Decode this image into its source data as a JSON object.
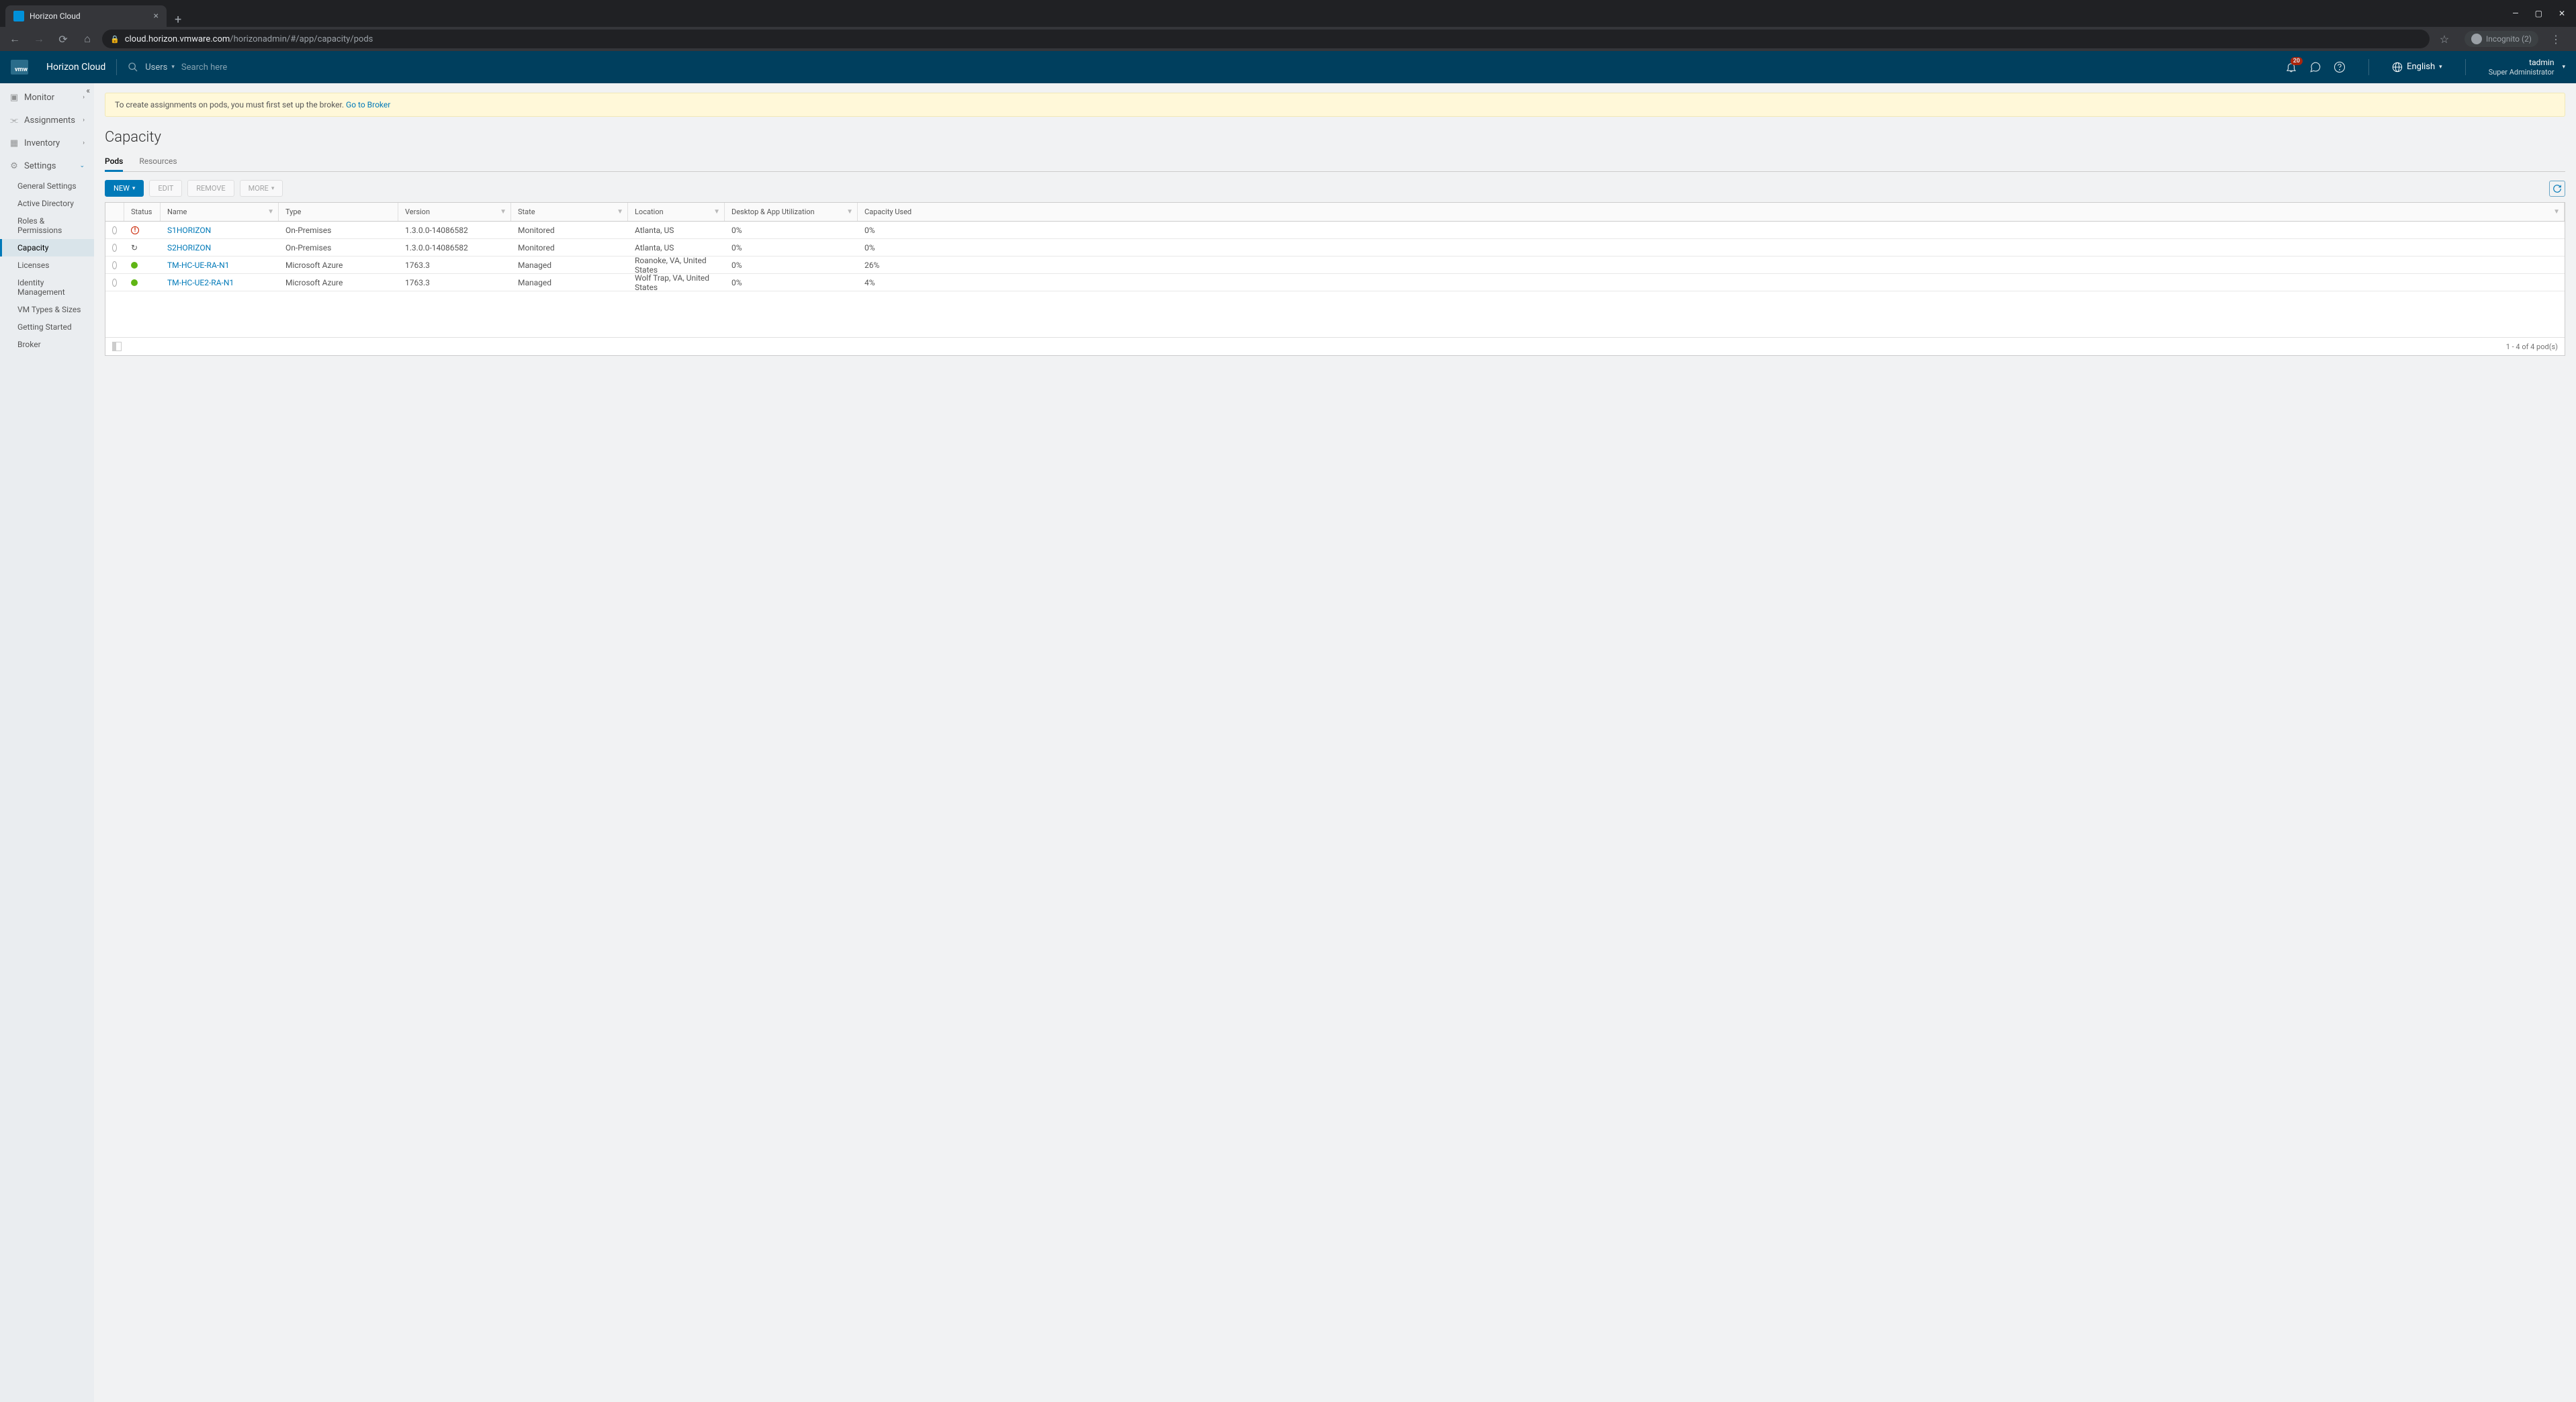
{
  "browser": {
    "tab_title": "Horizon Cloud",
    "url_domain": "cloud.horizon.vmware.com",
    "url_path": "/horizonadmin/#/app/capacity/pods",
    "incognito_label": "Incognito (2)"
  },
  "header": {
    "brand": "Horizon Cloud",
    "logo_text": "vmw",
    "users_label": "Users",
    "search_placeholder": "Search here",
    "notification_count": "20",
    "language": "English",
    "user_name": "tadmin",
    "user_role": "Super Administrator"
  },
  "sidebar": {
    "monitor": "Monitor",
    "assignments": "Assignments",
    "inventory": "Inventory",
    "settings": "Settings",
    "subs": {
      "general": "General Settings",
      "ad": "Active Directory",
      "roles": "Roles & Permissions",
      "capacity": "Capacity",
      "licenses": "Licenses",
      "identity": "Identity Management",
      "vmtypes": "VM Types & Sizes",
      "getting": "Getting Started",
      "broker": "Broker"
    }
  },
  "banner": {
    "text": "To create assignments on pods, you must first set up the broker. ",
    "link": "Go to Broker"
  },
  "page": {
    "title": "Capacity",
    "tabs": {
      "pods": "Pods",
      "resources": "Resources"
    },
    "toolbar": {
      "new": "NEW",
      "edit": "EDIT",
      "remove": "REMOVE",
      "more": "MORE"
    },
    "columns": {
      "status": "Status",
      "name": "Name",
      "type": "Type",
      "version": "Version",
      "state": "State",
      "location": "Location",
      "desktop": "Desktop & App Utilization",
      "capacity": "Capacity Used"
    },
    "rows": [
      {
        "status": "error",
        "name": "S1HORIZON",
        "type": "On-Premises",
        "version": "1.3.0.0-14086582",
        "state": "Monitored",
        "location": "Atlanta, US",
        "desktop": "0%",
        "capacity": "0%"
      },
      {
        "status": "sync",
        "name": "S2HORIZON",
        "type": "On-Premises",
        "version": "1.3.0.0-14086582",
        "state": "Monitored",
        "location": "Atlanta, US",
        "desktop": "0%",
        "capacity": "0%"
      },
      {
        "status": "ok",
        "name": "TM-HC-UE-RA-N1",
        "type": "Microsoft Azure",
        "version": "1763.3",
        "state": "Managed",
        "location": "Roanoke, VA, United States",
        "desktop": "0%",
        "capacity": "26%"
      },
      {
        "status": "ok",
        "name": "TM-HC-UE2-RA-N1",
        "type": "Microsoft Azure",
        "version": "1763.3",
        "state": "Managed",
        "location": "Wolf Trap, VA, United States",
        "desktop": "0%",
        "capacity": "4%"
      }
    ],
    "footer": "1 - 4 of 4 pod(s)"
  }
}
